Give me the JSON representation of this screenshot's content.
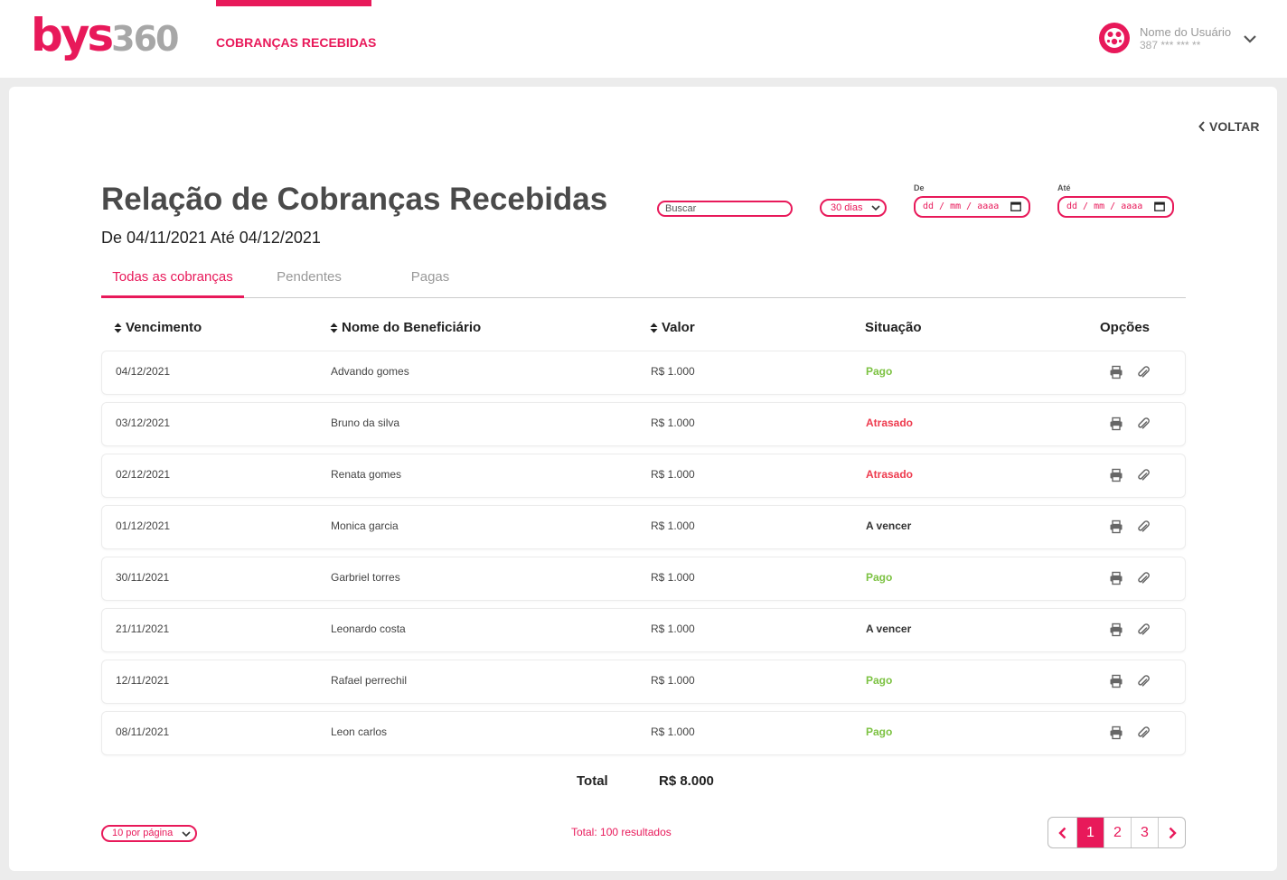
{
  "brand": {
    "logo_primary": "bys",
    "logo_secondary": "360",
    "accent_color": "#e8195a"
  },
  "nav": {
    "active_item": "COBRANÇAS RECEBIDAS"
  },
  "user": {
    "name": "Nome do Usuário",
    "account": "387 *** *** **",
    "avatar_icon": "user-avatar-icon",
    "menu_icon": "chevron-down-icon"
  },
  "page": {
    "back_label": "VOLTAR",
    "title": "Relação de Cobranças Recebidas",
    "period": "De 04/11/2021 Até 04/12/2021"
  },
  "filters": {
    "search_placeholder": "Buscar",
    "days_selected": "30 dias",
    "from_label": "De",
    "from_placeholder": "dd / mm / aaaa",
    "to_label": "Até",
    "to_placeholder": "dd / mm / aaaa"
  },
  "tabs": [
    {
      "label": "Todas as cobranças",
      "active": true
    },
    {
      "label": "Pendentes",
      "active": false
    },
    {
      "label": "Pagas",
      "active": false
    }
  ],
  "table": {
    "headers": {
      "due": "Vencimento",
      "beneficiary": "Nome do Beneficiário",
      "value": "Valor",
      "status": "Situação",
      "options": "Opções"
    },
    "rows": [
      {
        "due": "04/12/2021",
        "beneficiary": "Advando gomes",
        "value": "R$ 1.000",
        "status": "Pago",
        "status_type": "pago"
      },
      {
        "due": "03/12/2021",
        "beneficiary": "Bruno da silva",
        "value": "R$ 1.000",
        "status": "Atrasado",
        "status_type": "atrasado"
      },
      {
        "due": "02/12/2021",
        "beneficiary": "Renata gomes",
        "value": "R$ 1.000",
        "status": "Atrasado",
        "status_type": "atrasado"
      },
      {
        "due": "01/12/2021",
        "beneficiary": "Monica garcia",
        "value": "R$ 1.000",
        "status": "A vencer",
        "status_type": "avencer"
      },
      {
        "due": "30/11/2021",
        "beneficiary": "Garbriel torres",
        "value": "R$ 1.000",
        "status": "Pago",
        "status_type": "pago"
      },
      {
        "due": "21/11/2021",
        "beneficiary": "Leonardo costa",
        "value": "R$ 1.000",
        "status": "A vencer",
        "status_type": "avencer"
      },
      {
        "due": "12/11/2021",
        "beneficiary": "Rafael perrechil",
        "value": "R$ 1.000",
        "status": "Pago",
        "status_type": "pago"
      },
      {
        "due": "08/11/2021",
        "beneficiary": "Leon carlos",
        "value": "R$ 1.000",
        "status": "Pago",
        "status_type": "pago"
      }
    ],
    "total_label": "Total",
    "total_value": "R$ 8.000"
  },
  "footer": {
    "per_page": "10 por página",
    "results": "Total: 100 resultados",
    "pages": [
      "1",
      "2",
      "3"
    ],
    "current_page": "1"
  },
  "status_colors": {
    "pago": "#7cc242",
    "atrasado": "#ee3b4e",
    "avencer": "#333333"
  }
}
